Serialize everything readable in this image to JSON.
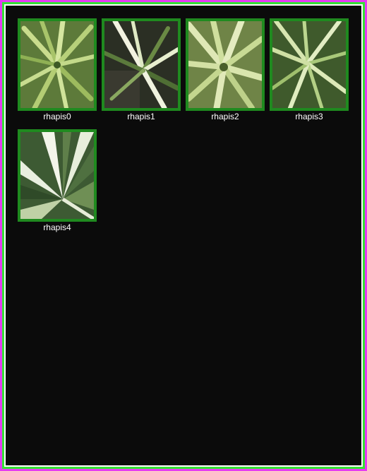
{
  "colors": {
    "frame_outer": "#e53bf2",
    "frame_mid": "#33e233",
    "panel_bg": "#0b0b0b",
    "thumb_border": "#1f8a1f",
    "caption_text": "#ffffff"
  },
  "gallery": {
    "items": [
      {
        "label": "rhapis0",
        "image": "rhapis-palm-leaves-photo"
      },
      {
        "label": "rhapis1",
        "image": "rhapis-palm-leaves-photo"
      },
      {
        "label": "rhapis2",
        "image": "rhapis-palm-leaves-photo"
      },
      {
        "label": "rhapis3",
        "image": "rhapis-palm-leaves-photo"
      },
      {
        "label": "rhapis4",
        "image": "rhapis-palm-leaves-photo"
      }
    ]
  }
}
